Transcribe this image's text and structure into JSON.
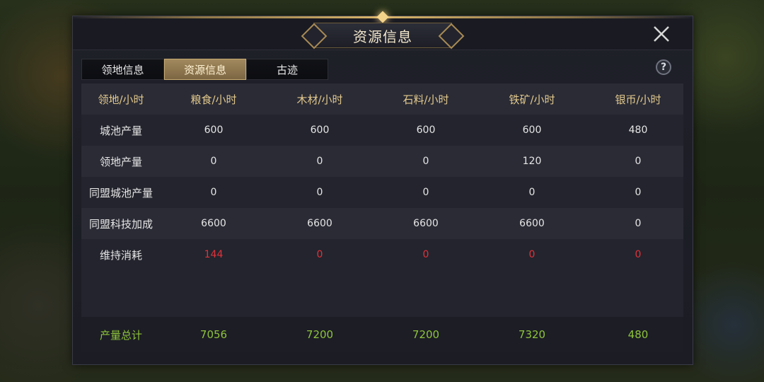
{
  "dialog": {
    "title": "资源信息",
    "close_icon": "close-icon",
    "help_icon": "help-icon",
    "help_glyph": "?"
  },
  "tabs": [
    {
      "label": "领地信息",
      "active": false
    },
    {
      "label": "资源信息",
      "active": true
    },
    {
      "label": "古迹",
      "active": false
    }
  ],
  "table": {
    "headers": [
      "领地/小时",
      "粮食/小时",
      "木材/小时",
      "石料/小时",
      "铁矿/小时",
      "银币/小时"
    ],
    "rows": [
      {
        "label": "城池产量",
        "values": [
          "600",
          "600",
          "600",
          "600",
          "480"
        ],
        "color": "normal"
      },
      {
        "label": "领地产量",
        "values": [
          "0",
          "0",
          "0",
          "120",
          "0"
        ],
        "color": "normal"
      },
      {
        "label": "同盟城池产量",
        "values": [
          "0",
          "0",
          "0",
          "0",
          "0"
        ],
        "color": "normal"
      },
      {
        "label": "同盟科技加成",
        "values": [
          "6600",
          "6600",
          "6600",
          "6600",
          "0"
        ],
        "color": "normal"
      },
      {
        "label": "维持消耗",
        "values": [
          "144",
          "0",
          "0",
          "0",
          "0"
        ],
        "color": "red"
      }
    ],
    "total": {
      "label": "产量总计",
      "values": [
        "7056",
        "7200",
        "7200",
        "7320",
        "480"
      ]
    }
  },
  "colors": {
    "header_text": "#e3c98d",
    "negative": "#e0323a",
    "total": "#8ec43a",
    "active_tab": "#a2895d"
  }
}
